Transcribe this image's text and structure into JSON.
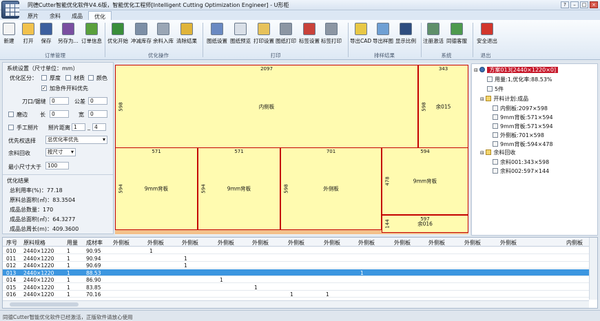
{
  "window": {
    "title": "同德Cutter智能优化软件V4.6版，智能优化工程师[Intelligent Cutting Optimization Engineer] - U形柜"
  },
  "tabs": [
    "原片",
    "余料",
    "成品",
    "优化"
  ],
  "ribbon": {
    "buttons": [
      {
        "label": "新建",
        "icon": "new-file-icon",
        "color": "#f3f3f3"
      },
      {
        "label": "打开",
        "icon": "folder-open-icon",
        "color": "#f2c24d"
      },
      {
        "label": "保存",
        "icon": "save-icon",
        "color": "#3d5f9e"
      },
      {
        "label": "另存为...",
        "icon": "save-as-icon",
        "color": "#7a4ea0"
      },
      {
        "label": "订单信息",
        "icon": "order-info-icon",
        "color": "#5aa03c"
      },
      {
        "label": "优化开始",
        "icon": "optimize-start-icon",
        "color": "#3a8e3a"
      },
      {
        "label": "冲减库存",
        "icon": "deduct-stock-icon",
        "color": "#7d8fa6"
      },
      {
        "label": "余料入库",
        "icon": "remnant-store-icon",
        "color": "#9aa6b5"
      },
      {
        "label": "清除结果",
        "icon": "clear-result-icon",
        "color": "#e0b43a"
      },
      {
        "label": "图纸设置",
        "icon": "drawing-settings-icon",
        "color": "#6a89c2"
      },
      {
        "label": "图纸预览",
        "icon": "drawing-preview-icon",
        "color": "#d9dfe7"
      },
      {
        "label": "打印设置",
        "icon": "print-settings-icon",
        "color": "#e7c25b"
      },
      {
        "label": "图纸打印",
        "icon": "drawing-print-icon",
        "color": "#8c96a3"
      },
      {
        "label": "标签设置",
        "icon": "label-settings-icon",
        "color": "#c9423a"
      },
      {
        "label": "标签打印",
        "icon": "label-print-icon",
        "color": "#8c96a3"
      },
      {
        "label": "导出CAD",
        "icon": "export-cad-icon",
        "color": "#e8c846"
      },
      {
        "label": "导出样图",
        "icon": "export-image-icon",
        "color": "#6fa0d4"
      },
      {
        "label": "显示比例",
        "icon": "zoom-ratio-icon",
        "color": "#2e4d7f"
      },
      {
        "label": "注册激活",
        "icon": "register-icon",
        "color": "#5f8f6a"
      },
      {
        "label": "同德客服",
        "icon": "customer-service-icon",
        "color": "#4e9a4e"
      },
      {
        "label": "安全退出",
        "icon": "exit-icon",
        "color": "#d2372c"
      }
    ],
    "groups": [
      "订单管理",
      "优化操作",
      "打印",
      "排样结果",
      "系统",
      "退出"
    ]
  },
  "left": {
    "system_title": "系统设置（尺寸单位：mm）",
    "opt_label": "优化区分：",
    "opt_thickness": "厚度",
    "opt_material": "材质",
    "opt_color": "颜色",
    "urgent_label": "加急件开料优先",
    "kerf_label": "刀口/锯缝",
    "kerf_value": "0",
    "tolerance_label": "公差",
    "tolerance_value": "0",
    "edge_label": "磨边",
    "long_label": "长",
    "long_value": "0",
    "wide_label": "宽",
    "wide_value": "0",
    "manual_label": "手工掰片",
    "distance_label": "掰片距离",
    "distance_a": "1",
    "distance_b": "4",
    "priority_label": "优先权选择",
    "priority_value": "总优化率优先",
    "remnant_label": "余料回收",
    "remnant_value": "按尺寸",
    "min_label": "最小尺寸大于",
    "min_value": "100",
    "result_title": "优化结果",
    "results": [
      "总利用率(%)：77.18",
      "原料总面积(㎡)：83.3504",
      "成品总数量：170",
      "成品总面积(㎡)：64.3277",
      "成品总周长(m)：409.3600"
    ]
  },
  "canvas": {
    "parts": [
      {
        "name": "内侧板",
        "w": "2097",
        "h": "598"
      },
      {
        "name": "余015",
        "w": "343",
        "h": "598"
      },
      {
        "name": "9mm背板",
        "w": "571",
        "h": "594"
      },
      {
        "name": "9mm背板",
        "w": "571",
        "h": "594"
      },
      {
        "name": "外侧板",
        "w": "701",
        "h": "598"
      },
      {
        "name": "9mm背板",
        "w": "594",
        "h": "478"
      },
      {
        "name": "余016",
        "w": "597",
        "h": "144"
      }
    ]
  },
  "tree": {
    "root": "方案013[2440×1220×0]",
    "usage": "用量:1,优化率:88.53%",
    "count": "5件",
    "plan": "开料计划:成品",
    "plan_items": [
      "内侧板:2097×598",
      "9mm背板:571×594",
      "9mm背板:571×594",
      "外侧板:701×598",
      "9mm背板:594×478"
    ],
    "remnant": "余料回收",
    "remnant_items": [
      "余料001:343×598",
      "余料002:597×144"
    ]
  },
  "grid": {
    "headers": [
      "序号",
      "原料规格",
      "用量",
      "成材率",
      "外侧板",
      "外侧板",
      "外侧板",
      "外侧板",
      "外侧板",
      "外侧板",
      "外侧板",
      "外侧板",
      "外侧板",
      "外侧板",
      "外侧板",
      "外侧板",
      "内侧板"
    ],
    "rows": [
      [
        "010",
        "2440×1220",
        "1",
        "90.95",
        "",
        "1",
        "",
        "",
        "",
        "",
        "",
        "",
        ""
      ],
      [
        "011",
        "2440×1220",
        "1",
        "90.94",
        "",
        "",
        "1",
        "",
        "",
        "",
        "",
        "",
        ""
      ],
      [
        "012",
        "2440×1220",
        "1",
        "90.69",
        "",
        "",
        "1",
        "",
        "",
        "",
        "",
        "",
        ""
      ],
      [
        "013",
        "2440×1220",
        "1",
        "88.53",
        "",
        "",
        "",
        "",
        "",
        "",
        "",
        "1",
        ""
      ],
      [
        "014",
        "2440×1220",
        "1",
        "86.90",
        "",
        "",
        "",
        "1",
        "",
        "",
        "",
        "",
        ""
      ],
      [
        "015",
        "2440×1220",
        "1",
        "83.85",
        "",
        "",
        "",
        "",
        "1",
        "",
        "",
        "",
        ""
      ],
      [
        "016",
        "2440×1220",
        "1",
        "70.16",
        "",
        "",
        "",
        "",
        "",
        "1",
        "1",
        "",
        ""
      ]
    ],
    "selected_row": 3
  },
  "status": "同德Cutter智能优化软件已经激活，正版软件请放心使用"
}
